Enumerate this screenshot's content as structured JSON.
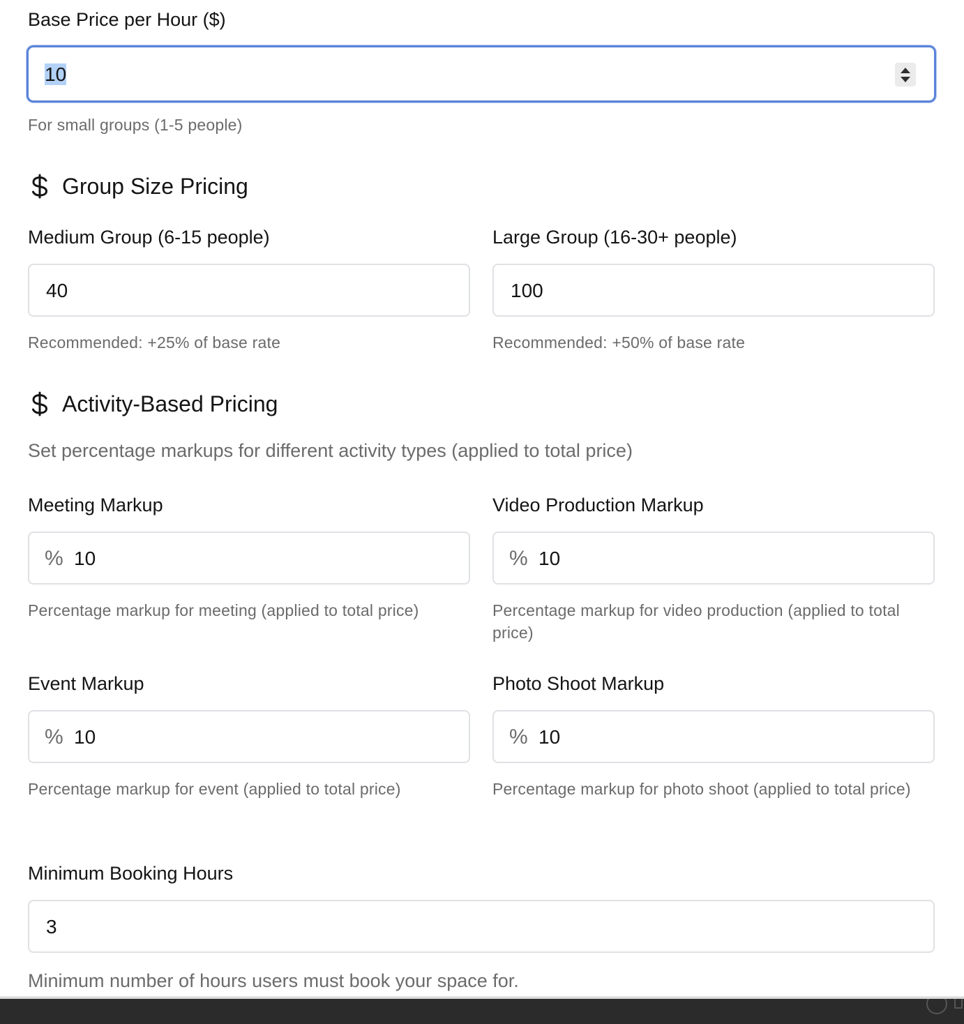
{
  "base_price": {
    "label": "Base Price per Hour ($)",
    "value": "10",
    "help": "For small groups (1-5 people)"
  },
  "group_pricing": {
    "title": "Group Size Pricing",
    "icon": "dollar-icon",
    "medium": {
      "label": "Medium Group (6-15 people)",
      "value": "40",
      "help": "Recommended: +25% of base rate"
    },
    "large": {
      "label": "Large Group (16-30+ people)",
      "value": "100",
      "help": "Recommended: +50% of base rate"
    }
  },
  "activity_pricing": {
    "title": "Activity-Based Pricing",
    "icon": "dollar-icon",
    "description": "Set percentage markups for different activity types (applied to total price)",
    "percent_symbol": "%",
    "meeting": {
      "label": "Meeting Markup",
      "value": "10",
      "help": "Percentage markup for meeting (applied to total price)"
    },
    "video": {
      "label": "Video Production Markup",
      "value": "10",
      "help": "Percentage markup for video production (applied to total price)"
    },
    "event": {
      "label": "Event Markup",
      "value": "10",
      "help": "Percentage markup for event (applied to total price)"
    },
    "photo": {
      "label": "Photo Shoot Markup",
      "value": "10",
      "help": "Percentage markup for photo shoot (applied to total price)"
    }
  },
  "min_booking": {
    "label": "Minimum Booking Hours",
    "value": "3",
    "help": "Minimum number of hours users must book your space for."
  },
  "colors": {
    "focus_border": "#5b84d9",
    "selection": "#b3d1f7",
    "help_text": "#6b6b6b",
    "field_border": "#dfe1e4"
  }
}
